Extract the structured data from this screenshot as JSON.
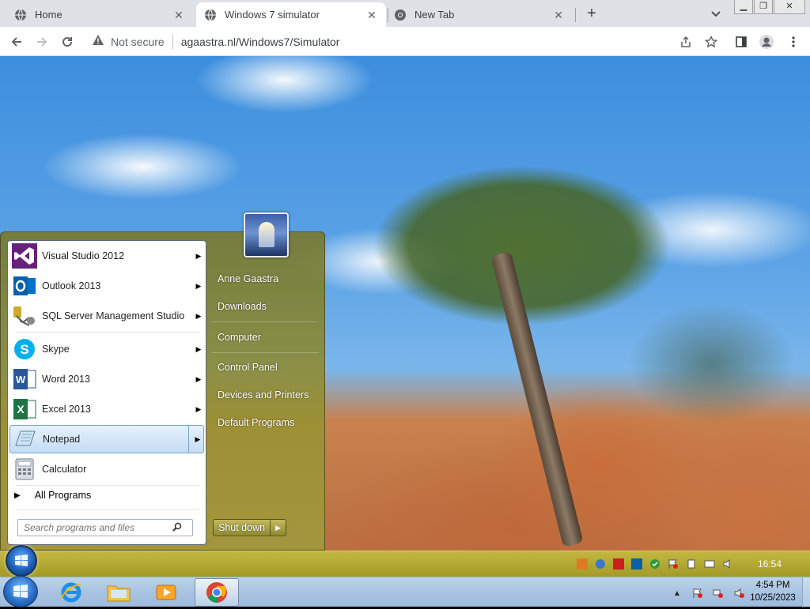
{
  "browser": {
    "tabs": [
      {
        "title": "Home",
        "favicon": "globe-icon",
        "close": "✕"
      },
      {
        "title": "Windows 7 simulator",
        "favicon": "globe-icon",
        "close": "✕"
      },
      {
        "title": "New Tab",
        "favicon": "chrome-icon",
        "close": "✕"
      }
    ],
    "new_tab": "+",
    "address": {
      "security_label": "Not secure",
      "url": "agaastra.nl/Windows7/Simulator"
    }
  },
  "startmenu": {
    "programs": [
      {
        "label": "Visual Studio 2012",
        "icon": "visual-studio-icon",
        "color": "#68217a",
        "arrow": "▶"
      },
      {
        "label": "Outlook 2013",
        "icon": "outlook-icon",
        "color": "#0072c6",
        "arrow": "▶"
      },
      {
        "label": "SQL Server Management Studio",
        "icon": "sql-server-icon",
        "color": "#cfa92e",
        "arrow": "▶"
      },
      {
        "label": "Skype",
        "icon": "skype-icon",
        "color": "#00aff0",
        "arrow": "▶"
      },
      {
        "label": "Word 2013",
        "icon": "word-icon",
        "color": "#2b579a",
        "arrow": "▶"
      },
      {
        "label": "Excel 2013",
        "icon": "excel-icon",
        "color": "#217346",
        "arrow": "▶"
      },
      {
        "label": "Notepad",
        "icon": "notepad-icon",
        "color": "#7fa9c9",
        "arrow": "▶"
      },
      {
        "label": "Calculator",
        "icon": "calculator-icon",
        "color": "#8a9bb0",
        "arrow": ""
      }
    ],
    "all_programs": "All Programs",
    "all_programs_arrow": "▶",
    "search_placeholder": "Search programs and files",
    "right_links": [
      "Anne Gaastra",
      "Downloads",
      "Computer",
      "Control Panel",
      "Devices and Printers",
      "Default Programs"
    ],
    "shutdown": "Shut down",
    "shutdown_arrow": "▶"
  },
  "sim_taskbar": {
    "clock": "16:54"
  },
  "host_taskbar": {
    "time": "4:54 PM",
    "date": "10/25/2023",
    "pinned": [
      "internet-explorer-icon",
      "explorer-icon",
      "media-player-icon",
      "chrome-icon"
    ]
  }
}
